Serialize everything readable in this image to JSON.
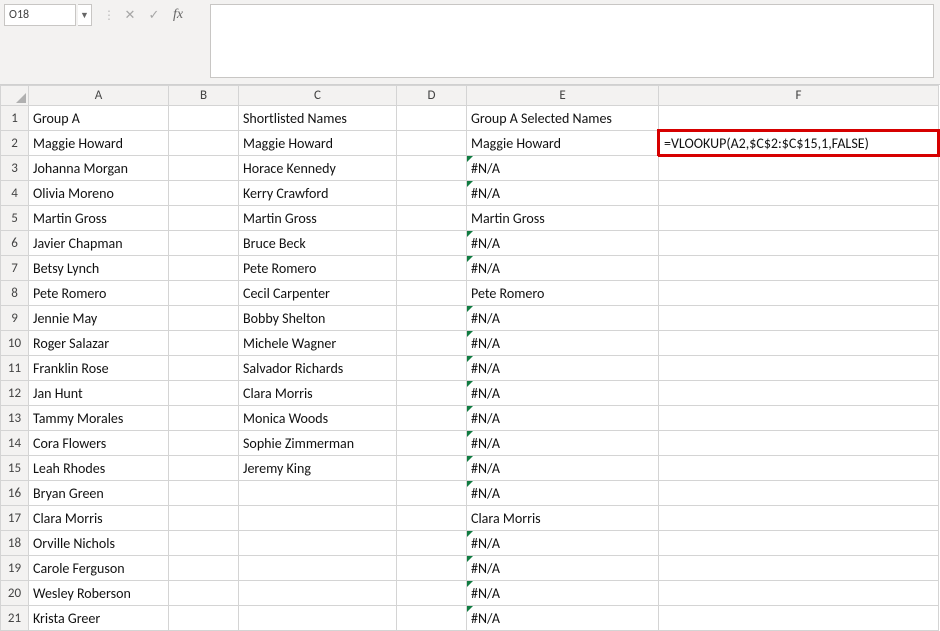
{
  "namebox": {
    "value": "O18"
  },
  "fx": {
    "cancel": "✕",
    "enter": "✓",
    "fx": "fx"
  },
  "headers": {
    "corner": "",
    "cols": [
      "A",
      "B",
      "C",
      "D",
      "E",
      "F"
    ]
  },
  "rows": [
    {
      "n": "1",
      "A": "Group A",
      "C": "Shortlisted Names",
      "E": "Group A Selected Names"
    },
    {
      "n": "2",
      "A": "Maggie Howard",
      "C": "Maggie Howard",
      "E": "Maggie Howard",
      "F": "=VLOOKUP(A2,$C$2:$C$15,1,FALSE)"
    },
    {
      "n": "3",
      "A": "Johanna Morgan",
      "C": "Horace Kennedy",
      "E": "#N/A"
    },
    {
      "n": "4",
      "A": "Olivia Moreno",
      "C": "Kerry Crawford",
      "E": "#N/A"
    },
    {
      "n": "5",
      "A": "Martin Gross",
      "C": "Martin Gross",
      "E": "Martin Gross"
    },
    {
      "n": "6",
      "A": "Javier Chapman",
      "C": "Bruce Beck",
      "E": "#N/A"
    },
    {
      "n": "7",
      "A": "Betsy Lynch",
      "C": "Pete Romero",
      "E": "#N/A"
    },
    {
      "n": "8",
      "A": "Pete Romero",
      "C": "Cecil Carpenter",
      "E": "Pete Romero"
    },
    {
      "n": "9",
      "A": "Jennie May",
      "C": "Bobby Shelton",
      "E": "#N/A"
    },
    {
      "n": "10",
      "A": "Roger Salazar",
      "C": "Michele Wagner",
      "E": "#N/A"
    },
    {
      "n": "11",
      "A": "Franklin Rose",
      "C": "Salvador Richards",
      "E": "#N/A"
    },
    {
      "n": "12",
      "A": "Jan Hunt",
      "C": "Clara Morris",
      "E": "#N/A"
    },
    {
      "n": "13",
      "A": "Tammy Morales",
      "C": "Monica Woods",
      "E": "#N/A"
    },
    {
      "n": "14",
      "A": "Cora Flowers",
      "C": "Sophie Zimmerman",
      "E": "#N/A"
    },
    {
      "n": "15",
      "A": "Leah Rhodes",
      "C": "Jeremy King",
      "E": "#N/A"
    },
    {
      "n": "16",
      "A": "Bryan Green",
      "E": "#N/A"
    },
    {
      "n": "17",
      "A": "Clara Morris",
      "E": "Clara Morris"
    },
    {
      "n": "18",
      "A": "Orville Nichols",
      "E": "#N/A"
    },
    {
      "n": "19",
      "A": "Carole Ferguson",
      "E": "#N/A"
    },
    {
      "n": "20",
      "A": "Wesley Roberson",
      "E": "#N/A"
    },
    {
      "n": "21",
      "A": "Krista Greer",
      "E": "#N/A"
    }
  ]
}
